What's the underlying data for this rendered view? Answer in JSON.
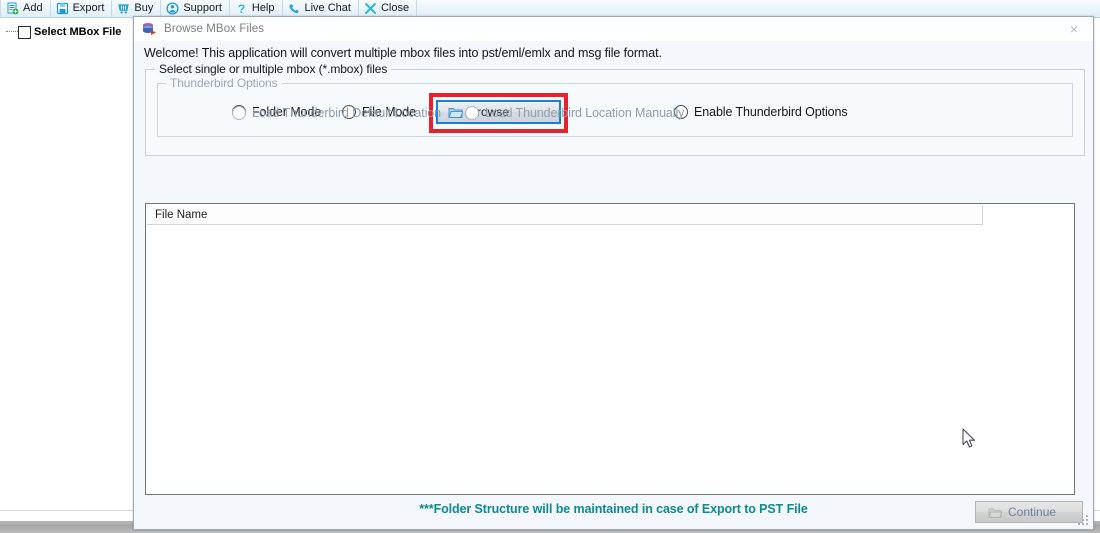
{
  "app": {
    "toolbar": [
      {
        "label": "Add",
        "icon": "add-file-icon"
      },
      {
        "label": "Export",
        "icon": "export-save-icon"
      },
      {
        "label": "Buy",
        "icon": "cart-icon"
      },
      {
        "label": "Support",
        "icon": "support-person-icon"
      },
      {
        "label": "Help",
        "icon": "question-mark-icon"
      },
      {
        "label": "Live Chat",
        "icon": "phone-icon"
      },
      {
        "label": "Close",
        "icon": "close-x-icon"
      }
    ],
    "tree": {
      "root_label": "Select MBox File",
      "checked": false
    }
  },
  "dialog": {
    "icon": "mbox-stack-icon",
    "title": "Browse MBox Files",
    "close_label": "×",
    "welcome": "Welcome! This application will convert multiple mbox files into pst/eml/emlx and msg file format.",
    "select_group": {
      "legend": "Select single or multiple mbox (*.mbox) files",
      "radios": {
        "folder_mode": "Folder Mode",
        "file_mode": "File Mode",
        "enable_thunderbird": "Enable Thunderbird Options"
      },
      "selected": "Folder Mode",
      "browse_button": {
        "label": "Browse",
        "icon": "folder-icon",
        "highlighted": true,
        "highlight_color": "#e8212d",
        "focus_color": "#1b7fd4"
      }
    },
    "thunderbird_group": {
      "legend": "Thunderbird Options",
      "enabled": false,
      "radios": {
        "default_location": "Load Thunderbird Default Location",
        "manual_location": "Load Thunderbird Location Manually"
      }
    },
    "file_list": {
      "columns": [
        "File Name"
      ],
      "rows": []
    },
    "footer": {
      "note": "***Folder Structure will be maintained in case of Export to PST File",
      "note_color": "#0d8a93",
      "continue_button": {
        "label": "Continue",
        "icon": "folder-icon",
        "enabled": false
      }
    }
  }
}
